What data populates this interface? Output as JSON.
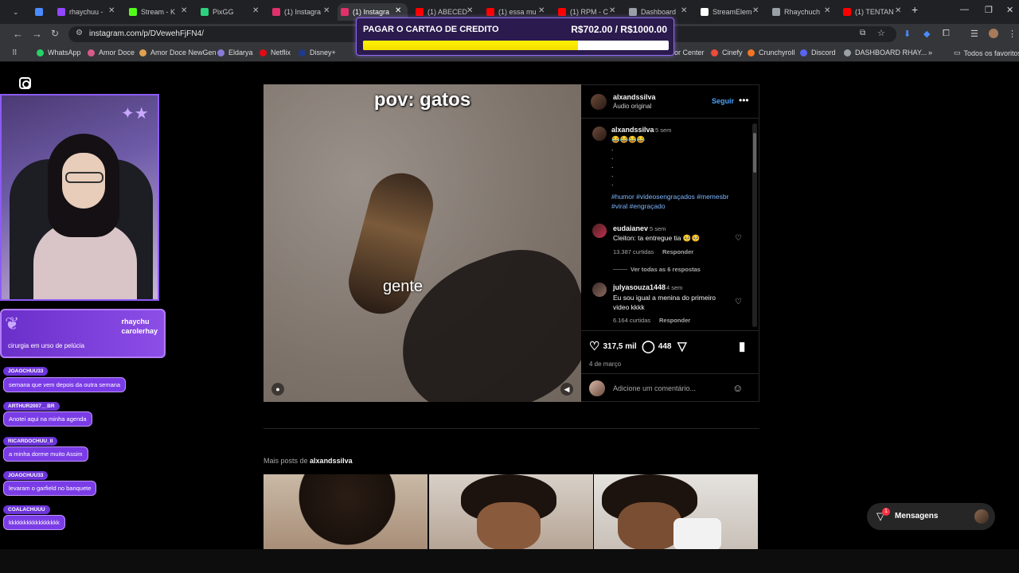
{
  "browser": {
    "tabs": [
      {
        "title": "rhaychuu -",
        "color": "#9146ff"
      },
      {
        "title": "Stream - K",
        "color": "#53fc18"
      },
      {
        "title": "PixGG",
        "color": "#2bd17e"
      },
      {
        "title": "(1) Instagra",
        "color": "#e1306c"
      },
      {
        "title": "(1) Instagra",
        "color": "#e1306c"
      },
      {
        "title": "(1) ABECED",
        "color": "#ff0000"
      },
      {
        "title": "(1) essa mu",
        "color": "#ff0000"
      },
      {
        "title": "(1) RPM - C",
        "color": "#ff0000"
      },
      {
        "title": "Dashboard",
        "color": "#9aa0a6"
      },
      {
        "title": "StreamElem",
        "color": "#ffffff"
      },
      {
        "title": "Rhaychuch",
        "color": "#9aa0a6"
      },
      {
        "title": "(1) TENTAN",
        "color": "#ff0000"
      }
    ],
    "url": "instagram.com/p/DVewehFjFN4/",
    "bookmarks": [
      {
        "label": "WhatsApp",
        "color": "#25d366"
      },
      {
        "label": "Amor Doce",
        "color": "#d95a8a"
      },
      {
        "label": "Amor Doce NewGen",
        "color": "#e0a050"
      },
      {
        "label": "Eldarya",
        "color": "#8a7ad8"
      },
      {
        "label": "Netflix",
        "color": "#e50914"
      },
      {
        "label": "Disney+",
        "color": "#1e3a8a"
      },
      {
        "label": "or Center",
        "color": "#35363a"
      },
      {
        "label": "Cinefy",
        "color": "#f04a3a"
      },
      {
        "label": "Crunchyroll",
        "color": "#f47521"
      },
      {
        "label": "Discord",
        "color": "#5865f2"
      },
      {
        "label": "DASHBOARD RHAY...",
        "color": "#9aa0a6"
      }
    ],
    "all_favorites": "Todos os favoritos"
  },
  "goal": {
    "title": "PAGAR O CARTAO DE CREDITO",
    "amount": "R$702.00 / R$1000.00",
    "progress": 0.702
  },
  "chat": {
    "banner_names": [
      "rhaychu",
      "carolerhay"
    ],
    "banner_msg": "cirurgia em urso de pelúcia",
    "messages": [
      {
        "user": "JOAOCHUU33",
        "text": "semana que vem depois da outra semana"
      },
      {
        "user": "ARTHUR2007__BR",
        "text": "Anotei aqui na minha agenda"
      },
      {
        "user": "RICARDOCHUU_II",
        "text": "a minha dorme muito Assim"
      },
      {
        "user": "JOAOCHUU33",
        "text": "levaram o garfield no banquete"
      },
      {
        "user": "COALACHUUU",
        "text": "kkkkkkkkkkkkkkkkk"
      }
    ]
  },
  "post": {
    "video_caption_top": "pov: gatos",
    "video_caption_mid": "gente",
    "author": "alxandssilva",
    "audio": "Áudio original",
    "follow": "Seguir",
    "caption": {
      "user": "alxandssilva",
      "time": "5 sem",
      "emojis": "😂😂😂😂",
      "dots": ".\n.\n.\n.\n.",
      "tags": "#humor #videosengraçados #memesbr #viral #engraçado"
    },
    "comments": [
      {
        "user": "eudaianev",
        "time": "5 sem",
        "text": "Cleiton: ta entregue tia 🥺🥺",
        "likes": "13.387 curtidas",
        "reply": "Responder"
      },
      {
        "user": "julyasouza1448",
        "time": "4 sem",
        "text": "Eu sou igual a menina do primeiro video kkkk",
        "likes": "6.164 curtidas",
        "reply": "Responder"
      }
    ],
    "view_replies": "Ver todas as 6 respostas",
    "likes": "317,5 mil",
    "comment_count": "448",
    "date": "4 de março",
    "add_comment_placeholder": "Adicione um comentário..."
  },
  "more_posts": {
    "prefix": "Mais posts de",
    "user": "alxandssilva"
  },
  "messages_button": {
    "label": "Mensagens",
    "badge": "1"
  }
}
